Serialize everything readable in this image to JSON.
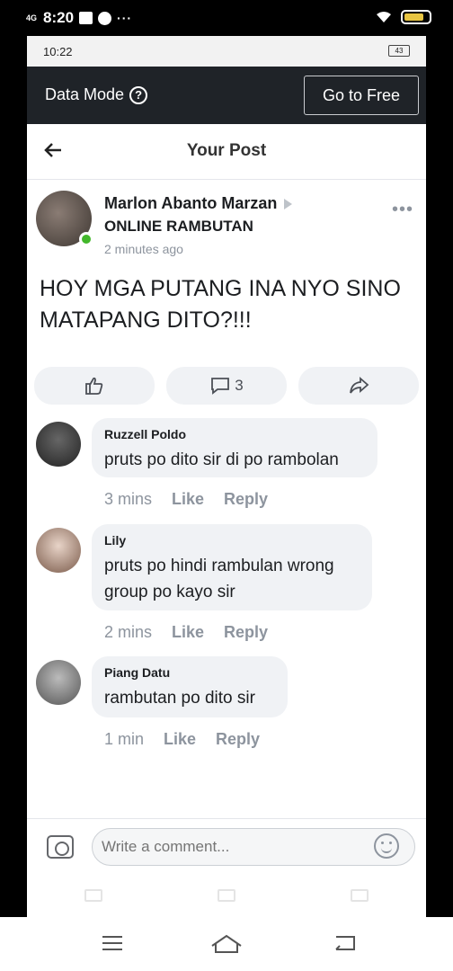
{
  "outer_status": {
    "time": "8:20",
    "network": "4G",
    "dots": "···"
  },
  "inner_status": {
    "time": "10:22",
    "battery": "43"
  },
  "data_mode": {
    "label": "Data Mode",
    "help": "?",
    "go_free": "Go to Free"
  },
  "topbar": {
    "title": "Your Post"
  },
  "post": {
    "author": "Marlon Abanto Marzan",
    "group": "ONLINE RAMBUTAN",
    "time": "2 minutes ago",
    "text": "HOY MGA PUTANG INA NYO SINO MATAPANG DITO?!!!",
    "comment_count": "3"
  },
  "comments": [
    {
      "name": "Ruzzell Poldo",
      "text": "pruts po dito sir di po rambolan",
      "time": "3 mins",
      "like": "Like",
      "reply": "Reply"
    },
    {
      "name": "Lily",
      "text": "pruts po hindi rambulan wrong group po kayo sir",
      "time": "2 mins",
      "like": "Like",
      "reply": "Reply"
    },
    {
      "name": "Piang Datu",
      "text": "rambutan po dito sir",
      "time": "1 min",
      "like": "Like",
      "reply": "Reply"
    }
  ],
  "composer": {
    "placeholder": "Write a comment..."
  },
  "colors": {
    "data_bar": "#1f2328",
    "online": "#42b72a",
    "bubble": "#f0f2f5"
  }
}
